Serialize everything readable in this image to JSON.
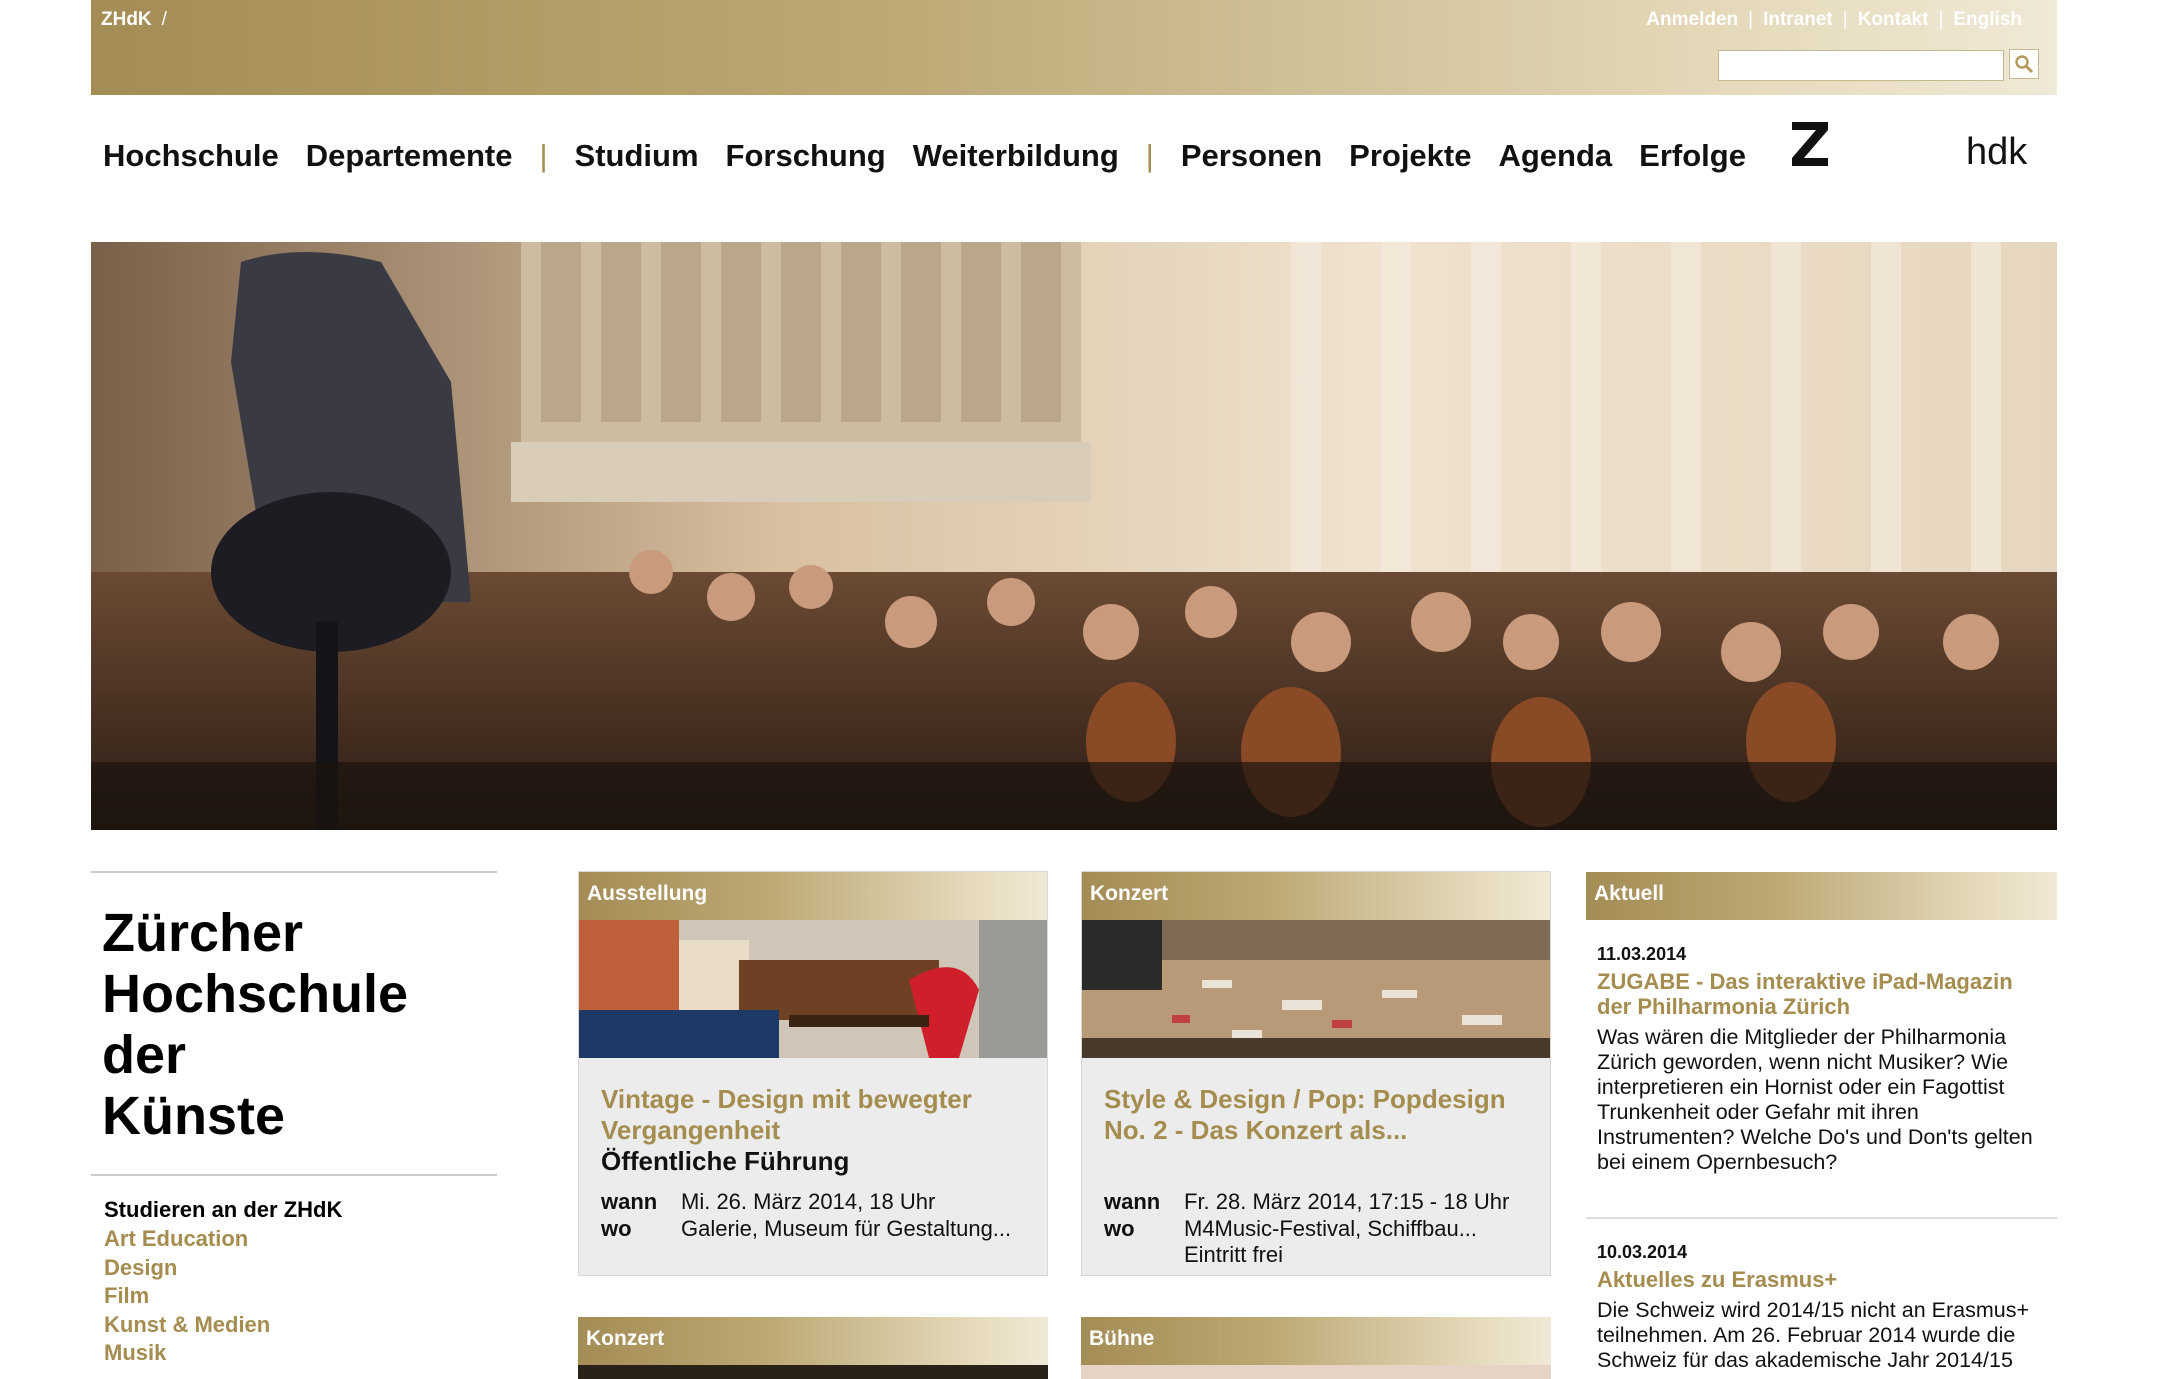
{
  "header": {
    "brand": "ZHdK",
    "brand_sep": "/",
    "utility_links": [
      "Anmelden",
      "Intranet",
      "Kontakt",
      "English"
    ],
    "search_value": ""
  },
  "nav": {
    "group1": [
      "Hochschule",
      "Departemente"
    ],
    "group2": [
      "Studium",
      "Forschung",
      "Weiterbildung"
    ],
    "group3": [
      "Personen",
      "Projekte",
      "Agenda",
      "Erfolge"
    ],
    "separator": "|",
    "logo_left": "z",
    "logo_right": "hdk"
  },
  "sidebar": {
    "title_lines": [
      "Zürcher",
      "Hochschule",
      "der",
      "Künste"
    ],
    "study_heading": "Studieren an der ZHdK",
    "study_links": [
      "Art Education",
      "Design",
      "Film",
      "Kunst & Medien",
      "Musik"
    ]
  },
  "cards": [
    {
      "category": "Ausstellung",
      "title": "Vintage - Design mit bewegter Vergangenheit",
      "subtitle": "Öffentliche Führung",
      "wann_label": "wann",
      "wann": "Mi. 26. März 2014, 18 Uhr",
      "wo_label": "wo",
      "wo": "Galerie, Museum für Gestaltung..."
    },
    {
      "category": "Konzert",
      "title": "Style & Design / Pop: Popdesign No. 2 - Das Konzert als...",
      "subtitle": "",
      "wann_label": "wann",
      "wann": "Fr. 28. März 2014, 17:15 - 18 Uhr",
      "wo_label": "wo",
      "wo": "M4Music-Festival, Schiffbau... Eintritt frei"
    }
  ],
  "lower_cards": [
    "Konzert",
    "Bühne"
  ],
  "news": {
    "heading": "Aktuell",
    "items": [
      {
        "date": "11.03.2014",
        "title": "ZUGABE - Das interaktive iPad-Magazin der Philharmonia Zürich",
        "text": "Was wären die Mitglieder der Philharmonia Zürich geworden, wenn nicht Musiker? Wie interpretieren ein Hornist oder ein Fagottist Trunkenheit oder Gefahr mit ihren Instrumenten? Welche Do's und Don'ts gelten bei einem Opernbesuch?"
      },
      {
        "date": "10.03.2014",
        "title": "Aktuelles zu Erasmus+",
        "text": "Die Schweiz wird 2014/15 nicht an Erasmus+ teilnehmen. Am 26. Februar 2014 wurde die Schweiz für das akademische Jahr 2014/15"
      }
    ]
  },
  "colors": {
    "gold": "#a58d4f",
    "gold_light": "#e6dbbd"
  }
}
